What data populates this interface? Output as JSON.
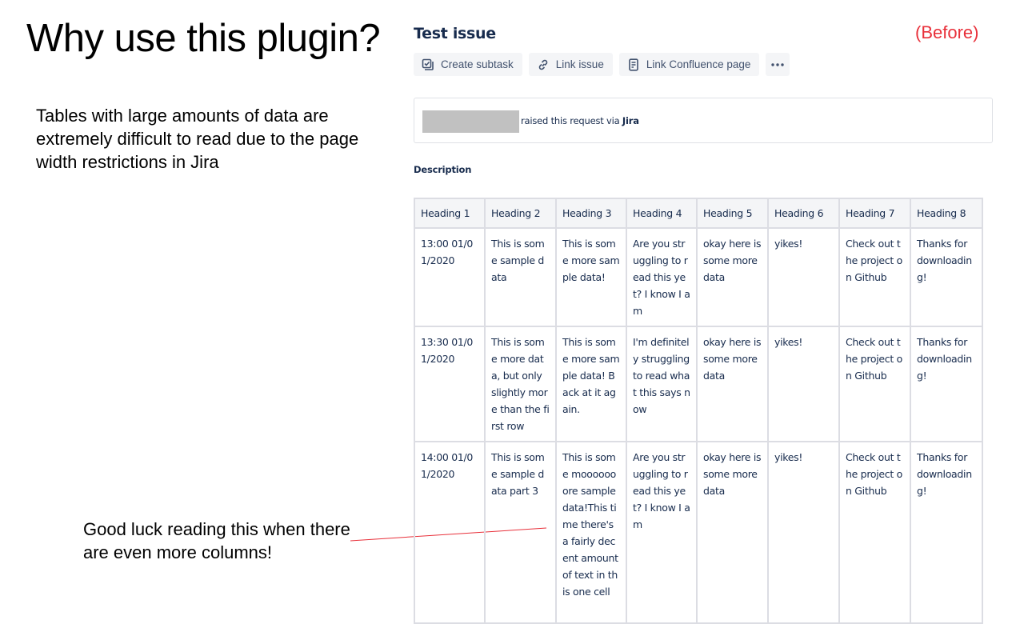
{
  "slide": {
    "title": "Why use this plugin?",
    "body": "Tables with large amounts of data are extremely difficult to read due to the page width restrictions in Jira",
    "note": "Good luck reading this when there are even more columns!",
    "state_label": "(Before)",
    "state_label_color": "#e8303a",
    "annotation_line_color": "#e8303a"
  },
  "issue": {
    "title": "Test issue",
    "toolbar": [
      {
        "icon": "create-subtask-icon",
        "label": "Create subtask"
      },
      {
        "icon": "link-icon",
        "label": "Link issue"
      },
      {
        "icon": "confluence-page-icon",
        "label": "Link Confluence page"
      },
      {
        "icon": "more-icon",
        "label": "•••"
      }
    ],
    "request": {
      "reporter_redacted": true,
      "text_prefix": "raised this request via ",
      "channel": "Jira"
    },
    "description_label": "Description",
    "table": {
      "headers": [
        "Heading 1",
        "Heading 2",
        "Heading 3",
        "Heading 4",
        "Heading 5",
        "Heading 6",
        "Heading 7",
        "Heading 8"
      ],
      "rows": [
        [
          "13:00 01/01/2020",
          "This is some sample data",
          "This is some more sample data!",
          "Are you struggling to read this yet? I know I am",
          "okay here is some more data",
          "yikes!",
          "Check out the project on Github",
          "Thanks for downloading!"
        ],
        [
          "13:30 01/01/2020",
          "This is some more data, but only slightly more than the first row",
          "This is some more sample data! Back at it again.",
          "I'm definitely struggling to read what this says now",
          "okay here is some more data",
          "yikes!",
          "Check out the project on Github",
          "Thanks for downloading!"
        ],
        [
          "14:00 01/01/2020",
          "This is some sample data part 3",
          "This is some mooooooore sample data!This time there's a fairly decent amount of text in this one cell",
          "Are you struggling to read this yet? I know I am",
          "okay here is some more data",
          "yikes!",
          "Check out the project on Github",
          "Thanks for downloading!"
        ]
      ]
    }
  },
  "colors": {
    "jira_text": "#172b4d",
    "toolbar_text": "#42526e",
    "button_bg": "#f4f5f7",
    "table_border": "#dcdde3",
    "redaction": "#c1c1c1"
  }
}
